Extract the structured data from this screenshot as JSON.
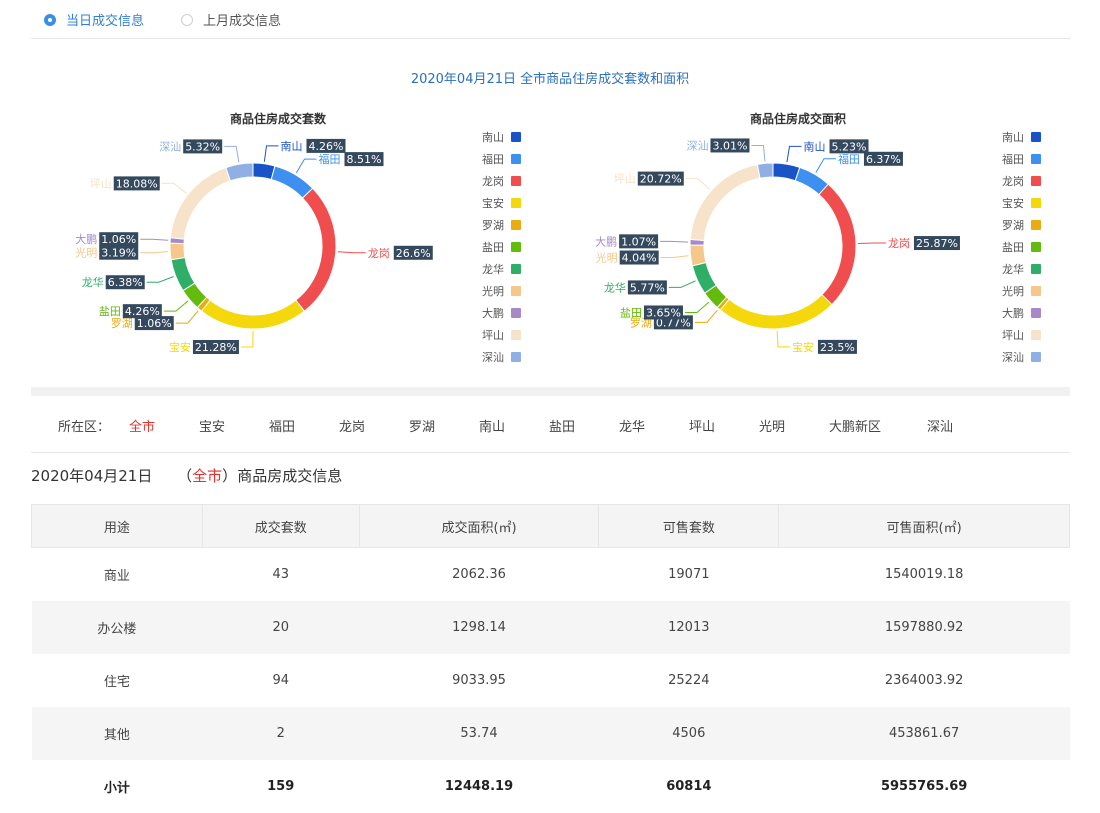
{
  "tabs": [
    {
      "label": "当日成交信息",
      "selected": true
    },
    {
      "label": "上月成交信息",
      "selected": false
    }
  ],
  "main_title": "2020年04月21日 全市商品住房成交套数和面积",
  "colors": {
    "南山": "#1a52c7",
    "福田": "#3d8ff0",
    "龙岗": "#f04e4e",
    "宝安": "#f5d80c",
    "罗湖": "#e9ab0f",
    "盐田": "#63bb0d",
    "龙华": "#2fae68",
    "光明": "#f6c78b",
    "大鹏": "#a68ac8",
    "坪山": "#f6e3c9",
    "深汕": "#90afe4"
  },
  "legend": [
    "南山",
    "福田",
    "龙岗",
    "宝安",
    "罗湖",
    "盐田",
    "龙华",
    "光明",
    "大鹏",
    "坪山",
    "深汕"
  ],
  "chart_data": [
    {
      "type": "pie",
      "title": "商品住房成交套数",
      "categories": [
        "南山",
        "福田",
        "龙岗",
        "宝安",
        "罗湖",
        "盐田",
        "龙华",
        "光明",
        "大鹏",
        "坪山",
        "深汕"
      ],
      "values": [
        4.26,
        8.51,
        26.6,
        21.28,
        1.06,
        4.26,
        6.38,
        3.19,
        1.06,
        18.08,
        5.32
      ],
      "labels": [
        "4.26%",
        "8.51%",
        "26.6%",
        "21.28%",
        "1.06%",
        "4.26%",
        "6.38%",
        "3.19%",
        "1.06%",
        "18.08%",
        "5.32%"
      ]
    },
    {
      "type": "pie",
      "title": "商品住房成交面积",
      "categories": [
        "南山",
        "福田",
        "龙岗",
        "宝安",
        "罗湖",
        "盐田",
        "龙华",
        "光明",
        "大鹏",
        "坪山",
        "深汕"
      ],
      "values": [
        5.23,
        6.37,
        25.87,
        23.5,
        0.77,
        3.65,
        5.77,
        4.04,
        1.07,
        20.72,
        3.01
      ],
      "labels": [
        "5.23%",
        "6.37%",
        "25.87%",
        "23.5%",
        "0.77%",
        "3.65%",
        "5.77%",
        "4.04%",
        "1.07%",
        "20.72%",
        "3.01%"
      ]
    }
  ],
  "filter": {
    "label": "所在区：",
    "items": [
      "全市",
      "宝安",
      "福田",
      "龙岗",
      "罗湖",
      "南山",
      "盐田",
      "龙华",
      "坪山",
      "光明",
      "大鹏新区",
      "深汕"
    ],
    "selected": "全市"
  },
  "info": {
    "date": "2020年04月21日",
    "city": "全市",
    "suffix": "商品房成交信息"
  },
  "table": {
    "headers": [
      "用途",
      "成交套数",
      "成交面积(㎡)",
      "可售套数",
      "可售面积(㎡)"
    ],
    "rows": [
      [
        "商业",
        "43",
        "2062.36",
        "19071",
        "1540019.18"
      ],
      [
        "办公楼",
        "20",
        "1298.14",
        "12013",
        "1597880.92"
      ],
      [
        "住宅",
        "94",
        "9033.95",
        "25224",
        "2364003.92"
      ],
      [
        "其他",
        "2",
        "53.74",
        "4506",
        "453861.67"
      ]
    ],
    "total": [
      "小计",
      "159",
      "12448.19",
      "60814",
      "5955765.69"
    ]
  }
}
